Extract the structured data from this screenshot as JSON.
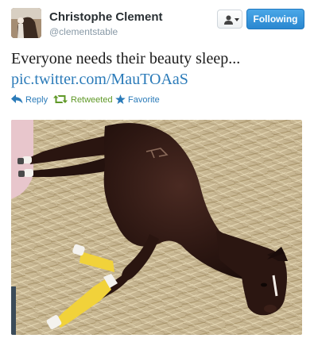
{
  "user": {
    "display_name": "Christophe Clement",
    "screen_name": "@clementstable"
  },
  "follow": {
    "label": "Following",
    "color": "#2a87d0"
  },
  "tweet": {
    "text": "Everyone needs their beauty sleep...",
    "link": "pic.twitter.com/MauTOAaS",
    "link_color": "#2b7bb9"
  },
  "actions": {
    "reply": {
      "label": "Reply",
      "icon": "reply-arrow-icon"
    },
    "retweet": {
      "label": "Retweeted",
      "icon": "retweet-icon",
      "color": "#609928"
    },
    "favorite": {
      "label": "Favorite",
      "icon": "star-icon"
    }
  },
  "icons": {
    "user_dropdown": "person-icon",
    "dropdown_caret": "caret-down-icon"
  }
}
